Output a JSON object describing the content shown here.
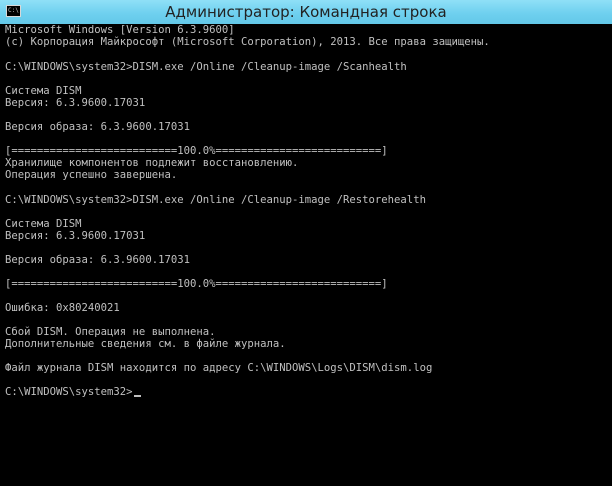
{
  "window": {
    "title": "Администратор: Командная строка",
    "icon_label": "C:\\"
  },
  "console": {
    "lines": [
      "Microsoft Windows [Version 6.3.9600]",
      "(c) Корпорация Майкрософт (Microsoft Corporation), 2013. Все права защищены.",
      "",
      "C:\\WINDOWS\\system32>DISM.exe /Online /Cleanup-image /Scanhealth",
      "",
      "Cистема DISM",
      "Версия: 6.3.9600.17031",
      "",
      "Версия образа: 6.3.9600.17031",
      "",
      "[==========================100.0%==========================]",
      "Хранилище компонентов подлежит восстановлению.",
      "Операция успешно завершена.",
      "",
      "C:\\WINDOWS\\system32>DISM.exe /Online /Cleanup-image /Restorehealth",
      "",
      "Cистема DISM",
      "Версия: 6.3.9600.17031",
      "",
      "Версия образа: 6.3.9600.17031",
      "",
      "[==========================100.0%==========================]",
      "",
      "Ошибка: 0x80240021",
      "",
      "Сбой DISM. Операция не выполнена.",
      "Дополнительные сведения см. в файле журнала.",
      "",
      "Файл журнала DISM находится по адресу C:\\WINDOWS\\Logs\\DISM\\dism.log",
      "",
      "C:\\WINDOWS\\system32>"
    ]
  }
}
